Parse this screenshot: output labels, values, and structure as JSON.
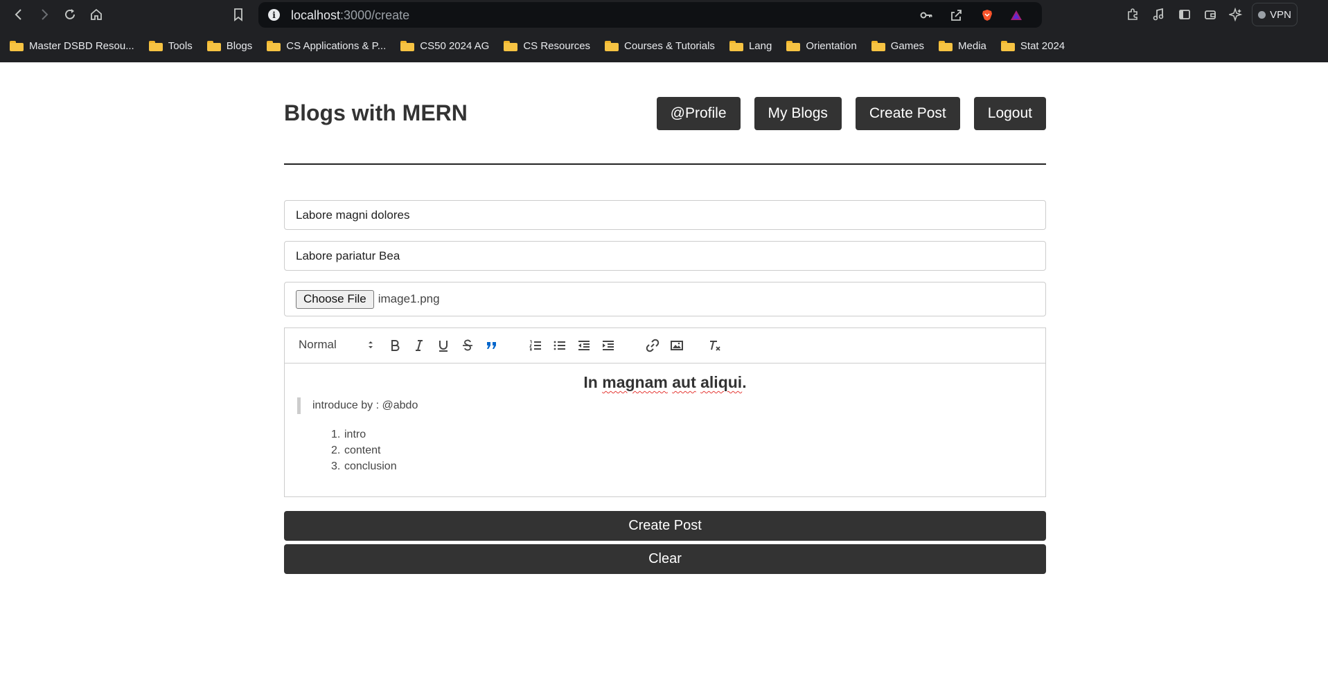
{
  "browser": {
    "url_host": "localhost",
    "url_path": ":3000/create",
    "vpn_label": "VPN",
    "bookmarks": [
      {
        "label": "Master DSBD Resou..."
      },
      {
        "label": "Tools"
      },
      {
        "label": "Blogs"
      },
      {
        "label": "CS Applications & P..."
      },
      {
        "label": "CS50 2024 AG"
      },
      {
        "label": "CS Resources"
      },
      {
        "label": "Courses & Tutorials"
      },
      {
        "label": "Lang"
      },
      {
        "label": "Orientation"
      },
      {
        "label": "Games"
      },
      {
        "label": "Media"
      },
      {
        "label": "Stat 2024"
      }
    ]
  },
  "header": {
    "brand": "Blogs with MERN",
    "nav": {
      "profile": "@Profile",
      "my_blogs": "My Blogs",
      "create_post": "Create Post",
      "logout": "Logout"
    }
  },
  "form": {
    "title_value": "Labore magni dolores",
    "summary_value": "Labore pariatur Bea",
    "file_button": "Choose File",
    "file_name": "image1.png",
    "editor": {
      "format_select": "Normal",
      "heading_words": [
        "In",
        "magnam",
        "aut",
        "aliqui"
      ],
      "heading_end": ".",
      "quote": "introduce by : @abdo",
      "list": [
        {
          "num": "1.",
          "text": "intro"
        },
        {
          "num": "2.",
          "text": "content"
        },
        {
          "num": "3.",
          "text": "conclusion"
        }
      ]
    },
    "submit_label": "Create Post",
    "clear_label": "Clear"
  },
  "colors": {
    "button_bg": "#333333",
    "chrome_bg": "#202124",
    "quote_icon_active": "#0066cc"
  }
}
